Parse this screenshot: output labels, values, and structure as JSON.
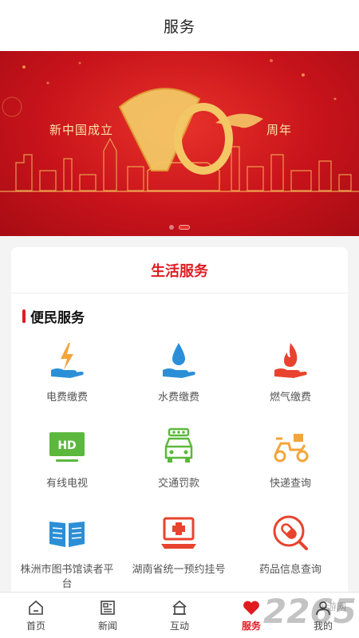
{
  "header": {
    "title": "服务"
  },
  "banner": {
    "text_left": "新中国成立",
    "text_right": "周年",
    "logo_number": "70",
    "slides": 2,
    "active_slide": 1
  },
  "card": {
    "title": "生活服务",
    "section_title": "便民服务",
    "items": [
      {
        "label": "电费缴费",
        "icon": "electricity-hand-icon"
      },
      {
        "label": "水费缴费",
        "icon": "water-drop-hand-icon"
      },
      {
        "label": "燃气缴费",
        "icon": "gas-flame-hand-icon"
      },
      {
        "label": "有线电视",
        "icon": "hd-tv-icon"
      },
      {
        "label": "交通罚款",
        "icon": "car-icon"
      },
      {
        "label": "快递查询",
        "icon": "delivery-scooter-icon"
      },
      {
        "label": "株洲市图书馆读者平台",
        "icon": "open-book-icon"
      },
      {
        "label": "湖南省统一预约挂号",
        "icon": "hospital-laptop-icon"
      },
      {
        "label": "药品信息查询",
        "icon": "pill-magnifier-icon"
      }
    ]
  },
  "tabbar": {
    "tabs": [
      {
        "label": "首页",
        "icon": "home-icon"
      },
      {
        "label": "新闻",
        "icon": "newspaper-icon"
      },
      {
        "label": "互动",
        "icon": "interact-house-icon"
      },
      {
        "label": "服务",
        "icon": "heart-icon",
        "active": true
      },
      {
        "label": "我的",
        "icon": "user-icon"
      }
    ]
  },
  "watermark": {
    "number": "2265",
    "text": "手游网"
  },
  "colors": {
    "accent": "#e01b22",
    "blue": "#2b8fd8",
    "orange": "#f3a53a",
    "green": "#5cb83c"
  }
}
